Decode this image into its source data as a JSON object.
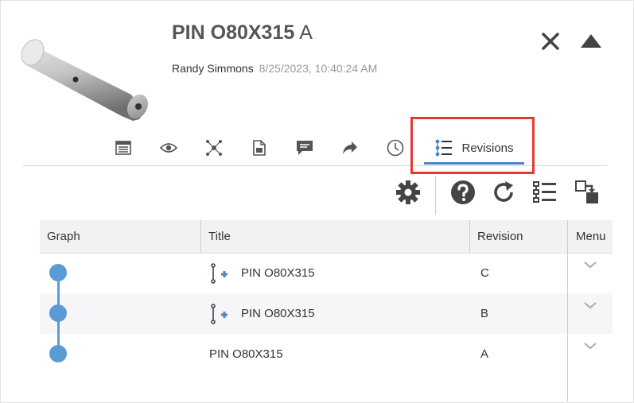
{
  "header": {
    "title": "PIN O80X315",
    "revision": "A",
    "author": "Randy Simmons",
    "date": "8/25/2023, 10:40:24 AM"
  },
  "tabs": {
    "items": [
      {
        "icon": "table-icon"
      },
      {
        "icon": "eye-icon"
      },
      {
        "icon": "network-icon"
      },
      {
        "icon": "document-icon"
      },
      {
        "icon": "comment-icon"
      },
      {
        "icon": "share-arrow-icon"
      },
      {
        "icon": "clock-icon"
      }
    ],
    "active_label": "Revisions",
    "active_icon": "revisions-tree-icon"
  },
  "toolbar": {
    "icons": [
      "gear-icon",
      "help-icon",
      "refresh-icon",
      "list-icon",
      "export-icon"
    ]
  },
  "table": {
    "columns": [
      "Graph",
      "Title",
      "Revision",
      "Menu"
    ],
    "rows": [
      {
        "title": "PIN O80X315",
        "revision": "C",
        "has_part_icon": true
      },
      {
        "title": "PIN O80X315",
        "revision": "B",
        "has_part_icon": true
      },
      {
        "title": "PIN O80X315",
        "revision": "A",
        "has_part_icon": false
      }
    ]
  },
  "colors": {
    "accent": "#4a86c5",
    "graph": "#5b9bd5",
    "highlight": "#e53935"
  }
}
